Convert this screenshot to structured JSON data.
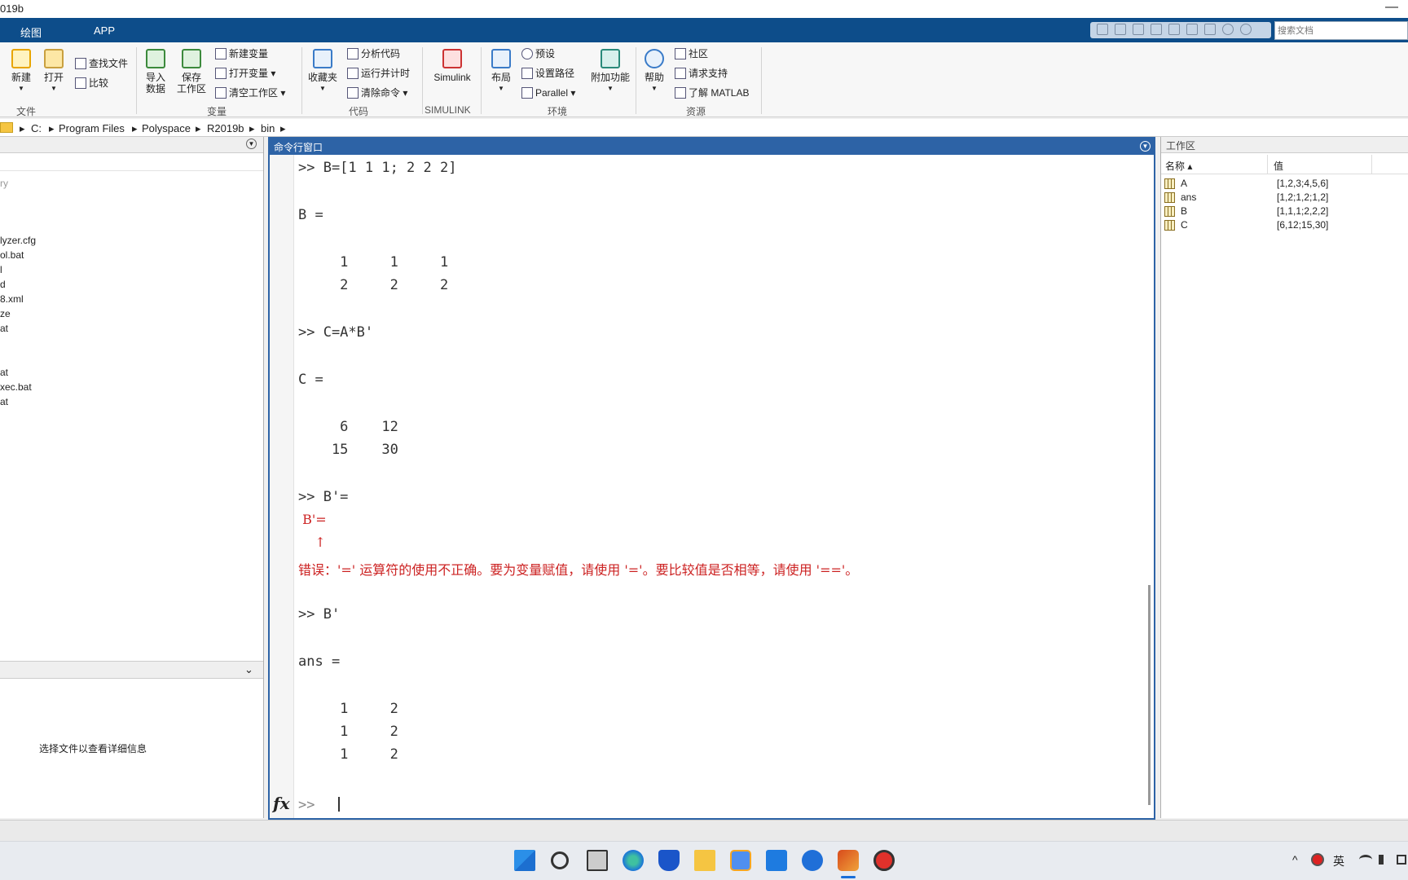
{
  "window": {
    "title_partial": "019b",
    "minimize": "—"
  },
  "tabs": [
    {
      "label": "绘图"
    },
    {
      "label": "APP"
    }
  ],
  "search": {
    "placeholder": "搜索文档"
  },
  "ribbon": {
    "file": {
      "new": "新建",
      "open": "打开",
      "find_files": "查找文件",
      "compare": "比较",
      "group": "文件"
    },
    "variable": {
      "import": "导入\n数据",
      "save": "保存\n工作区",
      "new_var": "新建变量",
      "open_var": "打开变量 ▾",
      "clear_ws": "清空工作区 ▾",
      "group": "变量"
    },
    "code": {
      "favorites": "收藏夹",
      "analyze": "分析代码",
      "run_time": "运行并计时",
      "clear_cmd": "清除命令 ▾",
      "group": "代码"
    },
    "simulink": {
      "label": "Simulink",
      "group": "SIMULINK"
    },
    "env": {
      "layout": "布局",
      "prefs": "预设",
      "set_path": "设置路径",
      "parallel": "Parallel ▾",
      "addons": "附加功能",
      "group": "环境"
    },
    "resources": {
      "help": "帮助",
      "community": "社区",
      "support": "请求支持",
      "learn": "了解 MATLAB",
      "group": "资源"
    }
  },
  "address": [
    "C:",
    "Program Files",
    "Polyspace",
    "R2019b",
    "bin"
  ],
  "files": {
    "items": [
      "ry",
      "lyzer.cfg",
      "ol.bat",
      "l",
      "d",
      "8.xml",
      "ze",
      "at",
      "at",
      "xec.bat",
      "at"
    ],
    "details_hint": "选择文件以查看详细信息"
  },
  "command_window": {
    "title": "命令行窗口",
    "lines": [
      ">> B=[1 1 1; 2 2 2]",
      "B =",
      "     1     1     1",
      "     2     2     2",
      ">> C=A*B'",
      "C =",
      "     6    12",
      "    15    30",
      ">> B'=",
      " B'=",
      "    ↑",
      "错误：'=' 运算符的使用不正确。要为变量赋值，请使用 '='。要比较值是否相等，请使用 '=='。",
      ">> B'",
      "ans =",
      "     1     2",
      "     1     2",
      "     1     2"
    ],
    "prompt": ">>",
    "fx": "fx"
  },
  "workspace": {
    "title": "工作区",
    "col_name": "名称 ▴",
    "col_value": "值",
    "rows": [
      {
        "name": "A",
        "value": "[1,2,3;4,5,6]"
      },
      {
        "name": "ans",
        "value": "[1,2;1,2;1,2]"
      },
      {
        "name": "B",
        "value": "[1,1,1;2,2,2]"
      },
      {
        "name": "C",
        "value": "[6,12;15,30]"
      }
    ]
  },
  "tray": {
    "lang": "英"
  }
}
